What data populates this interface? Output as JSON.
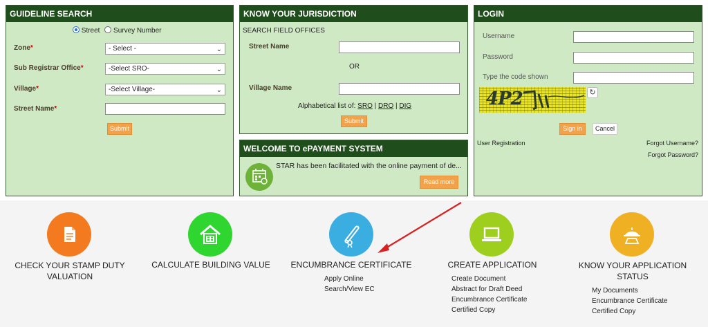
{
  "guideline": {
    "title": "GUIDELINE SEARCH",
    "radio_street": "Street",
    "radio_survey": "Survey Number",
    "zone_label": "Zone",
    "zone_value": "- Select -",
    "sro_label": "Sub Registrar Office",
    "sro_value": "-Select SRO-",
    "village_label": "Village",
    "village_value": "-Select Village-",
    "street_label": "Street Name",
    "required_mark": "*",
    "submit": "Submit"
  },
  "jurisdiction": {
    "title": "KNOW YOUR JURISDICTION",
    "subtitle": "SEARCH FIELD OFFICES",
    "street_label": "Street Name",
    "or_text": "OR",
    "village_label": "Village Name",
    "alpha_prefix": "Alphabetical list of:",
    "link_sro": "SRO",
    "link_dro": "DRO",
    "link_dig": "DIG",
    "sep": "|",
    "submit": "Submit"
  },
  "epayment": {
    "title": "WELCOME TO ePAYMENT SYSTEM",
    "text": "STAR has been facilitated with the online payment of de...",
    "read_more": "Read more"
  },
  "login": {
    "title": "LOGIN",
    "username_label": "Username",
    "password_label": "Password",
    "code_label": "Type the code shown",
    "captcha_text": "4P2",
    "signin": "Sign in",
    "cancel": "Cancel",
    "user_registration": "User Registration",
    "forgot_username": "Forgot Username?",
    "forgot_password": "Forgot Password?"
  },
  "services": [
    {
      "title": "CHECK YOUR STAMP DUTY VALUATION",
      "color": "#f47a20",
      "icon": "document-icon",
      "links": []
    },
    {
      "title": "CALCULATE BUILDING VALUE",
      "color": "#2fd62f",
      "icon": "house-icon",
      "links": []
    },
    {
      "title": "ENCUMBRANCE CERTIFICATE",
      "color": "#3aaee0",
      "icon": "scroll-icon",
      "links": [
        "Apply Online",
        "Search/View EC"
      ]
    },
    {
      "title": "CREATE APPLICATION",
      "color": "#9fcf1e",
      "icon": "laptop-icon",
      "links": [
        "Create Document",
        "Abstract for Draft Deed",
        "Encumbrance Certificate",
        "Certified Copy"
      ]
    },
    {
      "title": "KNOW YOUR APPLICATION STATUS",
      "color": "#f0b023",
      "icon": "status-icon",
      "links": [
        "My Documents",
        "Encumbrance Certificate",
        "Certified Copy"
      ]
    }
  ],
  "colors": {
    "panel_header": "#1f4d1b",
    "panel_bg": "#cfe9c4",
    "button_orange": "#f2a24a",
    "annotation_arrow": "#d92020"
  }
}
